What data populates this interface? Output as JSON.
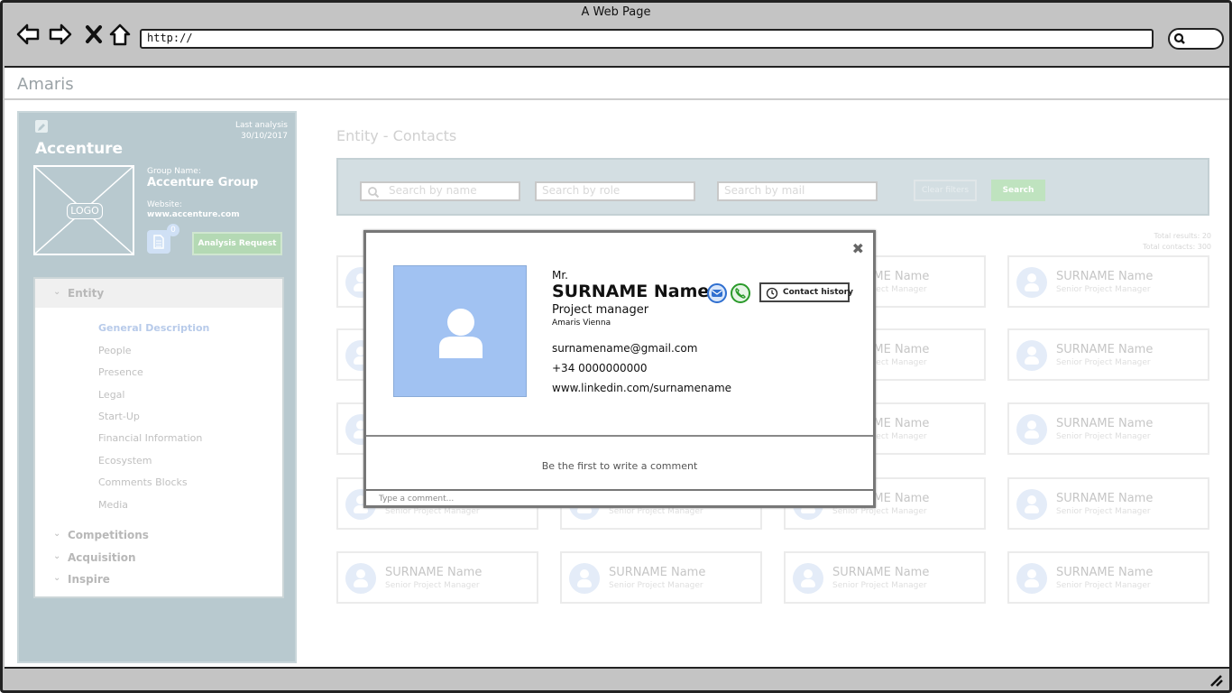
{
  "browser": {
    "title": "A Web Page",
    "url": "http://",
    "icons": [
      "back-icon",
      "forward-icon",
      "close-icon",
      "home-icon",
      "search-icon",
      "resize-grip-icon"
    ]
  },
  "app": {
    "name": "Amaris"
  },
  "sidebar": {
    "last_analysis_label": "Last analysis",
    "last_analysis_date": "30/10/2017",
    "company": "Accenture",
    "logo_text": "LOGO",
    "group_label": "Group Name:",
    "group_value": "Accenture Group",
    "website_label": "Website:",
    "website_value": "www.accenture.com",
    "doc_count": "0",
    "analysis_button": "Analysis Request",
    "tree": {
      "entity": "Entity",
      "entity_items": [
        "General Description",
        "People",
        "Presence",
        "Legal",
        "Start-Up",
        "Financial Information",
        "Ecosystem",
        "Comments Blocks",
        "Media"
      ],
      "active_item": "General Description",
      "other_sections": [
        "Competitions",
        "Acquisition",
        "Inspire"
      ]
    }
  },
  "main": {
    "title": "Entity - Contacts",
    "filters": {
      "name_placeholder": "Search by name",
      "role_placeholder": "Search by role",
      "mail_placeholder": "Search by mail",
      "clear_label": "Clear filters",
      "search_label": "Search"
    },
    "total_results": "Total results: 20",
    "total_contacts": "Total contacts: 300",
    "card_name": "SURNAME Name",
    "card_role": "Senior Project Manager"
  },
  "modal": {
    "salutation": "Mr.",
    "name": "SURNAME Name",
    "role": "Project manager",
    "office": "Amaris Vienna",
    "email": "surnamename@gmail.com",
    "phone": "+34 0000000000",
    "linkedin": "www.linkedin.com/surnamename",
    "history_label": "Contact history",
    "comment_empty": "Be the first to write a comment",
    "comment_placeholder": "Type a comment...",
    "colors": {
      "photo_bg": "#a1c2f2",
      "mail_icon": "#2f6fd0",
      "phone_icon": "#2a9a2a"
    }
  }
}
